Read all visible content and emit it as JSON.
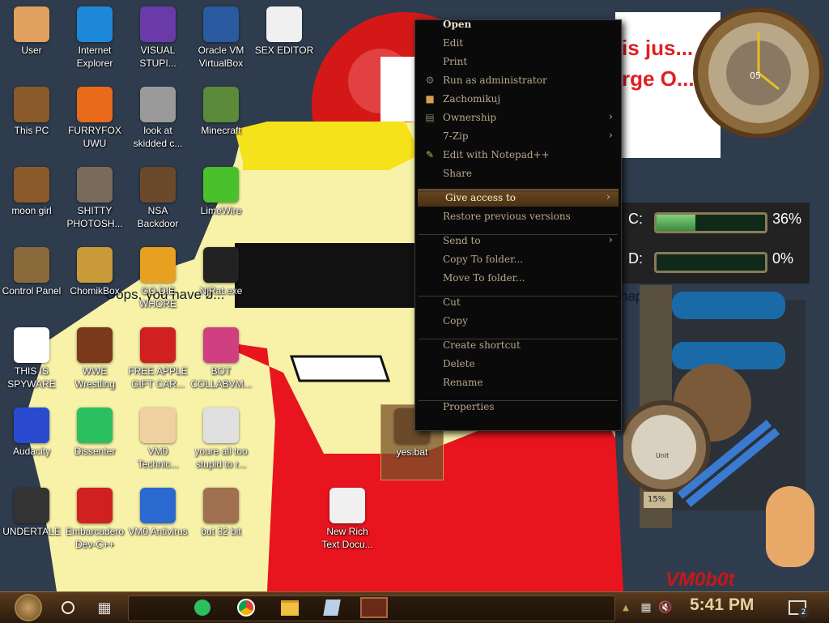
{
  "desktop_icons": [
    {
      "label": "User",
      "icon": "user-face-icon",
      "color": "#e0a060"
    },
    {
      "label": "Internet Explorer",
      "icon": "edge-icon",
      "color": "#1e88d8"
    },
    {
      "label": "VISUAL STUPI...",
      "icon": "visual-studio-icon",
      "color": "#6a3aa8"
    },
    {
      "label": "Oracle VM VirtualBox",
      "icon": "virtualbox-icon",
      "color": "#2a5aa0"
    },
    {
      "label": "SEX EDITOR",
      "icon": "hxd-icon",
      "color": "#f0f0f0"
    },
    {
      "label": "This PC",
      "icon": "computer-icon",
      "color": "#8a5a2a"
    },
    {
      "label": "FURRYFOX UWU",
      "icon": "firefox-icon",
      "color": "#e86a1a"
    },
    {
      "label": "look at skidded c...",
      "icon": "files-icon",
      "color": "#9a9a9a"
    },
    {
      "label": "Minecraft",
      "icon": "grass-block-icon",
      "color": "#5a8a3a"
    },
    {
      "label": "moon girl",
      "icon": "folder-icon",
      "color": "#8a5a2a"
    },
    {
      "label": "SHITTY PHOTOSH...",
      "icon": "gimp-icon",
      "color": "#7a6a5a"
    },
    {
      "label": "NSA Backdoor",
      "icon": "steampunk-folder-icon",
      "color": "#6a4a2a"
    },
    {
      "label": "LimeWire",
      "icon": "limewire-icon",
      "color": "#4ac02a"
    },
    {
      "label": "Control Panel",
      "icon": "lightbulb-icon",
      "color": "#8a6a3a"
    },
    {
      "label": "ChomikBox",
      "icon": "hamster-box-icon",
      "color": "#c89a3a"
    },
    {
      "label": "GO DIE WHORE",
      "icon": "de-icon",
      "color": "#e8a020"
    },
    {
      "label": "NjRat.exe",
      "icon": "skull-icon",
      "color": "#222222"
    },
    {
      "label": "THIS IS SPYWARE",
      "icon": "chrome-icon",
      "color": "#ffffff"
    },
    {
      "label": "WWE Wrestling",
      "icon": "tv-icon",
      "color": "#7a3a1a"
    },
    {
      "label": "FREE APPLE GIFT CAR...",
      "icon": "apple-icon",
      "color": "#d02020"
    },
    {
      "label": "BOT COLLABVM...",
      "icon": "monitor-icon",
      "color": "#d04080"
    },
    {
      "label": "Audacity",
      "icon": "audacity-icon",
      "color": "#2a4ad0"
    },
    {
      "label": "Dissenter",
      "icon": "speech-icon",
      "color": "#2ac060"
    },
    {
      "label": "VM0 Technic...",
      "icon": "doctor-icon",
      "color": "#f0d0a0"
    },
    {
      "label": "youre all too stupid to r...",
      "icon": "portrait-icon",
      "color": "#e0e0e0"
    },
    {
      "label": "yes.bat",
      "icon": "steampunk-file-icon",
      "color": "#6a4a2a"
    },
    {
      "label": "UNDERTALE",
      "icon": "unity-icon",
      "color": "#333333"
    },
    {
      "label": "Embarcadero Dev-C++",
      "icon": "devcpp-icon",
      "color": "#d02020"
    },
    {
      "label": "VM0 Antivirus",
      "icon": "shield-icon",
      "color": "#2a6ad0"
    },
    {
      "label": "but 32 bit",
      "icon": "portrait-woman-icon",
      "color": "#a07050"
    },
    {
      "label": "New Rich Text Docu...",
      "icon": "document-icon",
      "color": "#f0f0f0"
    }
  ],
  "wallpaper": {
    "banner_text": "is jus... rge O... 4",
    "overlay_text": "Oops, you have b...",
    "overlay_text_2": "hap",
    "watermark": "VM0b0t"
  },
  "context_menu": {
    "items": [
      {
        "label": "Open",
        "bold": true
      },
      {
        "label": "Edit"
      },
      {
        "label": "Print"
      },
      {
        "label": "Run as administrator",
        "icon": "shield-icon"
      },
      {
        "label": "Zachomikuj",
        "icon": "hamster-icon"
      },
      {
        "label": "Ownership",
        "icon": "ownership-icon",
        "submenu": true
      },
      {
        "label": "7-Zip",
        "submenu": true
      },
      {
        "label": "Edit with Notepad++",
        "icon": "notepad-icon"
      },
      {
        "label": "Share"
      },
      {
        "label": "Give access to",
        "submenu": true,
        "highlighted": true
      },
      {
        "label": "Restore previous versions"
      },
      {
        "label": "Send to",
        "submenu": true
      },
      {
        "label": "Copy To folder..."
      },
      {
        "label": "Move To folder..."
      },
      {
        "label": "Cut"
      },
      {
        "label": "Copy"
      },
      {
        "label": "Create shortcut"
      },
      {
        "label": "Delete"
      },
      {
        "label": "Rename"
      },
      {
        "label": "Properties"
      }
    ]
  },
  "widgets": {
    "drive_c": {
      "letter": "C:",
      "percent": "36%",
      "fill": 0.36
    },
    "drive_d": {
      "letter": "D:",
      "percent": "0%",
      "fill": 0.0
    },
    "gauge_percent": "15%",
    "gauge_label": "Unit",
    "clock_face_text": "05"
  },
  "taskbar": {
    "time": "5:41 PM",
    "notification_count": "2",
    "pinned": [
      "dissenter-icon",
      "chrome-icon",
      "file-explorer-icon",
      "notepad-icon",
      "steampunk-app-icon"
    ]
  }
}
